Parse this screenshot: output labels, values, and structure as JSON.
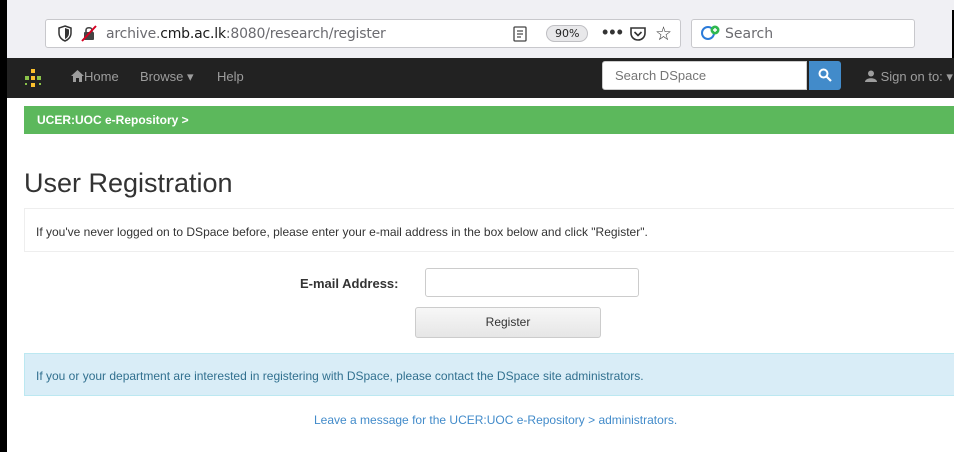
{
  "browser": {
    "url_prefix": "archive.",
    "url_domain": "cmb.ac.lk",
    "url_rest": ":8080/research/register",
    "zoom": "90%",
    "more": "•••",
    "search_placeholder": "Search"
  },
  "navbar": {
    "home": "Home",
    "browse": "Browse ▾",
    "help": "Help",
    "search_placeholder": "Search DSpace",
    "sign_on": "Sign on to: ▾"
  },
  "breadcrumb": {
    "label": "UCER:UOC e-Repository >"
  },
  "page": {
    "title": "User Registration",
    "intro": "If you've never logged on to DSpace before, please enter your e-mail address in the box below and click \"Register\".",
    "email_label": "E-mail Address:",
    "register_button": "Register",
    "info_text": "If you or your department are interested in registering with DSpace, please contact the DSpace site administrators.",
    "leave_message": "Leave a message for the UCER:UOC e-Repository > administrators."
  },
  "colors": {
    "navbar_bg": "#222222",
    "breadcrumb_bg": "#5cb85c",
    "info_bg": "#d9edf7",
    "link": "#428bca",
    "search_button": "#428bca"
  }
}
